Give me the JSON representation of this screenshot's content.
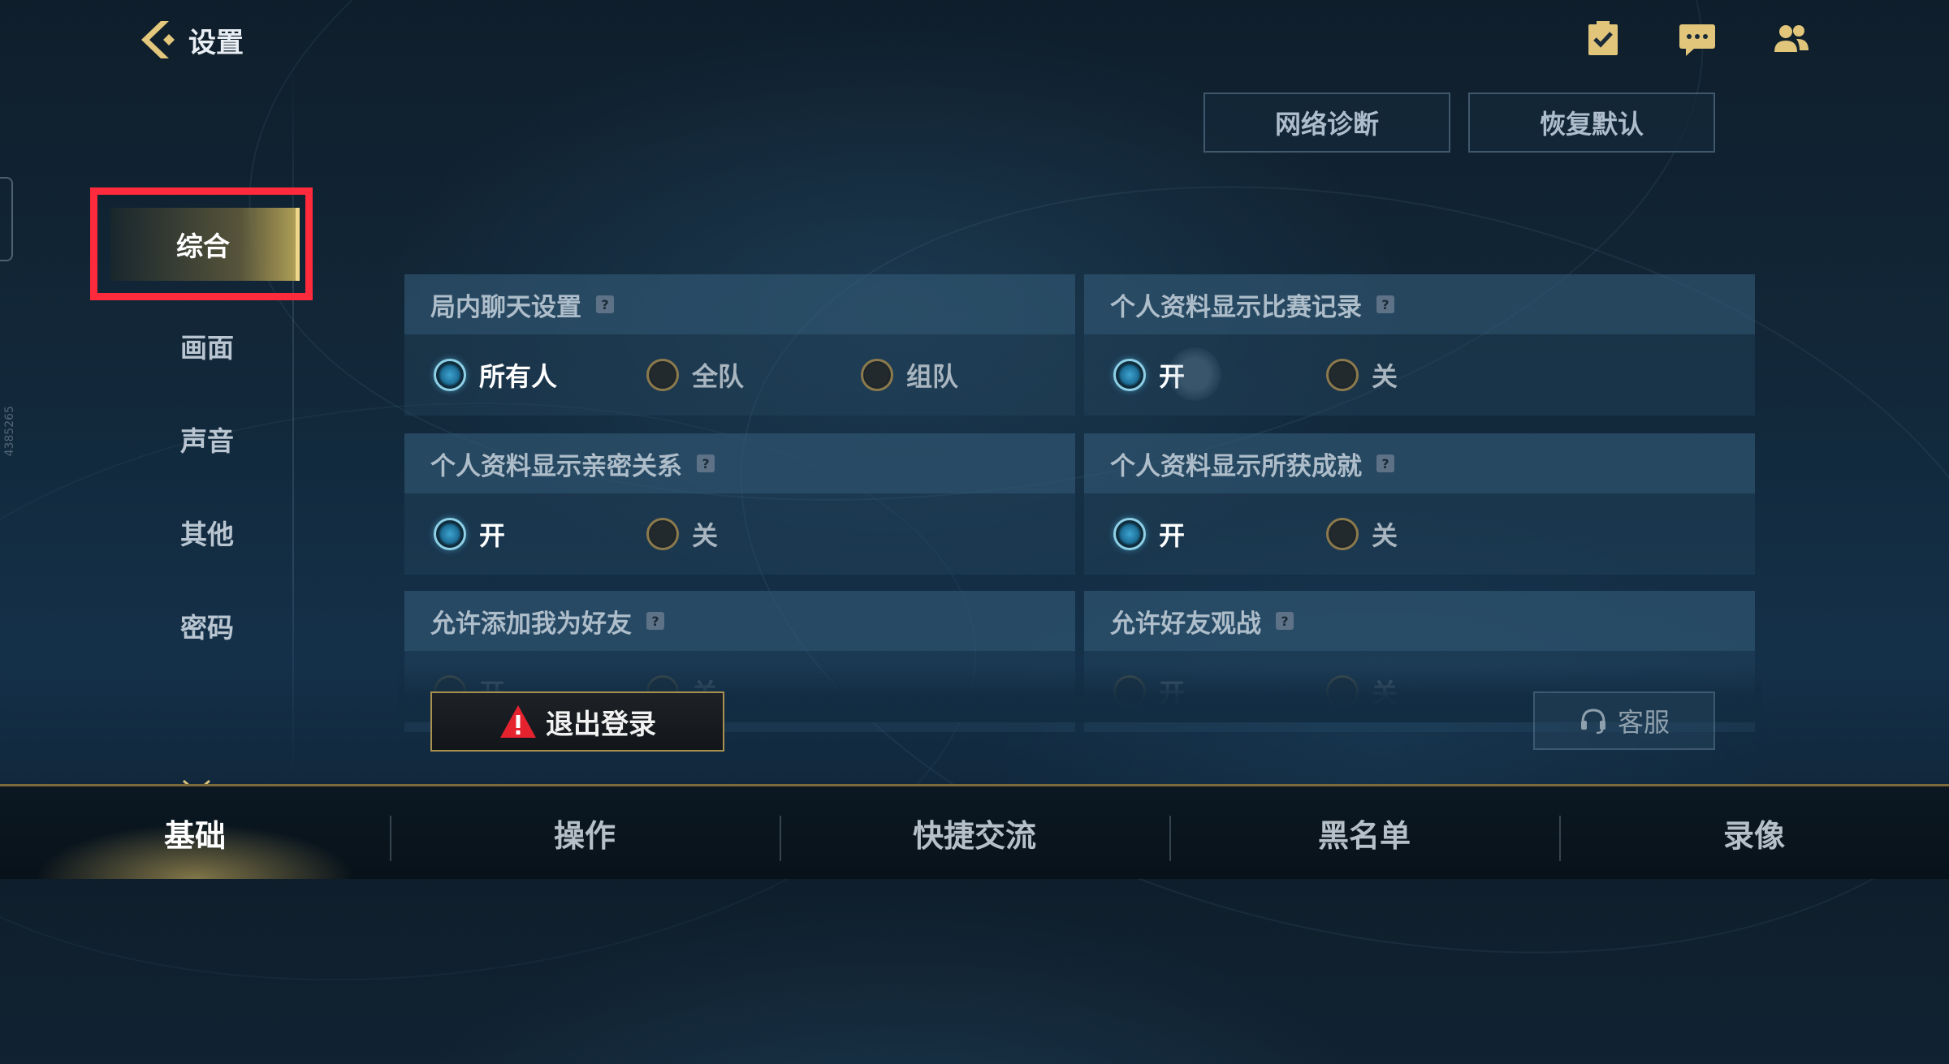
{
  "header": {
    "title": "设置",
    "icons": [
      "task-clipboard-icon",
      "chat-message-icon",
      "friends-icon"
    ]
  },
  "actions": {
    "network_diagnosis": "网络诊断",
    "restore_default": "恢复默认"
  },
  "side_id": "4385265",
  "sidebar": {
    "items": [
      {
        "label": "综合",
        "active": true
      },
      {
        "label": "画面"
      },
      {
        "label": "声音"
      },
      {
        "label": "其他"
      },
      {
        "label": "密码"
      }
    ]
  },
  "settings": {
    "in_game_chat": {
      "title": "局内聊天设置",
      "options": [
        "所有人",
        "全队",
        "组队"
      ],
      "selected": "所有人"
    },
    "show_match_record": {
      "title": "个人资料显示比赛记录",
      "options": [
        "开",
        "关"
      ],
      "selected": "开"
    },
    "show_intimacy": {
      "title": "个人资料显示亲密关系",
      "options": [
        "开",
        "关"
      ],
      "selected": "开"
    },
    "show_achievements": {
      "title": "个人资料显示所获成就",
      "options": [
        "开",
        "关"
      ],
      "selected": "开"
    },
    "allow_add_friend": {
      "title": "允许添加我为好友",
      "options": [
        "开",
        "关"
      ],
      "selected": "开"
    },
    "allow_friend_spectate": {
      "title": "允许好友观战",
      "options": [
        "开",
        "关"
      ],
      "selected": "开"
    }
  },
  "help_glyph": "?",
  "buttons": {
    "logout": "退出登录",
    "customer_service": "客服"
  },
  "tabs": [
    {
      "label": "基础",
      "active": true
    },
    {
      "label": "操作"
    },
    {
      "label": "快捷交流"
    },
    {
      "label": "黑名单"
    },
    {
      "label": "录像"
    }
  ],
  "colors": {
    "highlight_box": "#ff2a3c",
    "accent_gold": "#f0d78a",
    "radio_on": "#3ea3cf"
  }
}
